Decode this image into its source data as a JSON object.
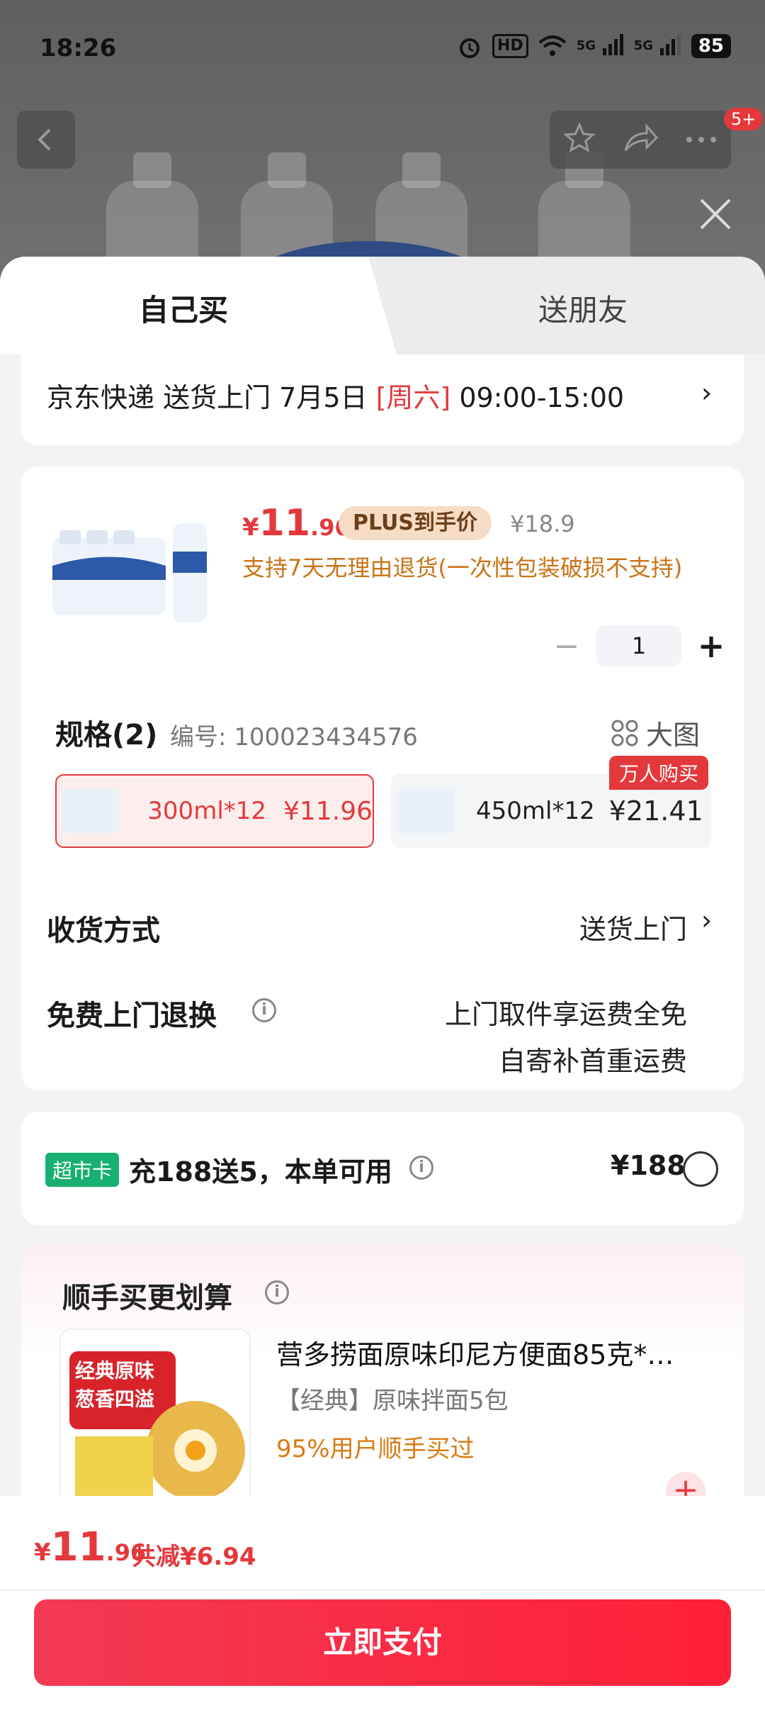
{
  "status_bar": {
    "time": "18:26",
    "hd": "HD",
    "net1": "5G",
    "net2": "5G",
    "battery": "85"
  },
  "top": {
    "badge": "5+"
  },
  "tabs": {
    "self": "自己买",
    "friend": "送朋友"
  },
  "delivery": {
    "text": "京东快递 送货上门 7月5日 ",
    "weekday": "[周六]",
    "time": " 09:00-15:00"
  },
  "product": {
    "price_currency": "¥",
    "price_int": "11",
    "price_dec": ".96",
    "plus_label": "PLUS到手价",
    "original_price": "¥18.9",
    "return_note": "支持7天无理由退货(一次性包装破损不支持)",
    "quantity": "1"
  },
  "spec": {
    "title": "规格(2)",
    "code": "编号: 100023434576",
    "big_pic": "大图",
    "options": [
      {
        "label": "300ml*12",
        "price": "¥11.96",
        "selected": true
      },
      {
        "label": "450ml*12",
        "price": "¥21.41",
        "selected": false,
        "tag": "万人购买"
      }
    ]
  },
  "shipping": {
    "label": "收货方式",
    "value": "送货上门"
  },
  "free_return": {
    "label": "免费上门退换",
    "line1": "上门取件享运费全免",
    "line2": "自寄补首重运费"
  },
  "coupon": {
    "tag": "超市卡",
    "text": "充188送5，本单可用",
    "price": "¥188"
  },
  "upsell": {
    "title": "顺手买更划算",
    "item_name": "营多捞面原味印尼方便面85克*…",
    "item_sub": "【经典】原味拌面5包",
    "item_stat": "95%用户顺手买过",
    "thumb_text1": "经典原味",
    "thumb_text2": "葱香四溢"
  },
  "bottom": {
    "currency": "¥",
    "total_int": "11",
    "total_dec": ".96",
    "discount": "共减¥6.94",
    "pay_label": "立即支付"
  },
  "colors": {
    "accent": "#e4393c",
    "orange": "#c97418",
    "green": "#18b071"
  }
}
